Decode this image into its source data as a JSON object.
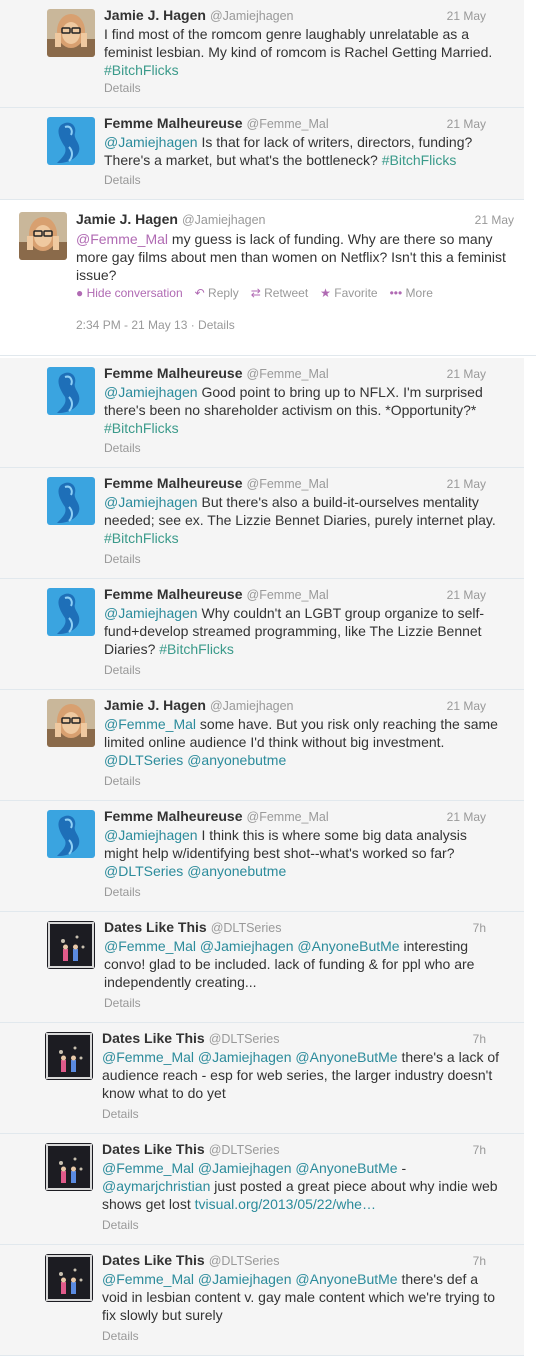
{
  "tweets": [
    {
      "name": "Jamie J. Hagen",
      "handle": "@Jamiejhagen",
      "time": "21 May",
      "avatar": "jamie",
      "segments": [
        {
          "t": "I find most of the romcom genre laughably unrelatable as a feminist lesbian.  My kind of romcom is Rachel Getting Married. ",
          "c": ""
        },
        {
          "t": "#BitchFlicks",
          "c": "hash"
        }
      ],
      "details": "Details"
    },
    {
      "name": "Femme Malheureuse",
      "handle": "@Femme_Mal",
      "time": "21 May",
      "avatar": "femme",
      "segments": [
        {
          "t": "@Jamiejhagen",
          "c": "mention"
        },
        {
          "t": " Is that for lack of writers, directors, funding? There's a market, but what's the bottleneck? ",
          "c": ""
        },
        {
          "t": "#BitchFlicks",
          "c": "hash"
        }
      ],
      "details": "Details"
    }
  ],
  "expanded": {
    "name": "Jamie J. Hagen",
    "handle": "@Jamiejhagen",
    "time": "21 May",
    "avatar": "jamie",
    "segments": [
      {
        "t": "@Femme_Mal",
        "c": "mention-purple"
      },
      {
        "t": " my guess is lack of funding. Why are there so many more gay films about men than women on Netflix? Isn't this a feminist issue?",
        "c": ""
      }
    ],
    "actions": {
      "hide": "Hide conversation",
      "reply": "Reply",
      "retweet": "Retweet",
      "favorite": "Favorite",
      "more": "More"
    },
    "timestamp": "2:34 PM - 21 May 13 · Details"
  },
  "replies": [
    {
      "name": "Femme Malheureuse",
      "handle": "@Femme_Mal",
      "time": "21 May",
      "avatar": "femme",
      "segments": [
        {
          "t": "@Jamiejhagen",
          "c": "mention"
        },
        {
          "t": " Good point to bring up to NFLX. I'm surprised there's been no shareholder activism on this. *Opportunity?* ",
          "c": ""
        },
        {
          "t": "#BitchFlicks",
          "c": "hash"
        }
      ],
      "details": "Details"
    },
    {
      "name": "Femme Malheureuse",
      "handle": "@Femme_Mal",
      "time": "21 May",
      "avatar": "femme",
      "segments": [
        {
          "t": "@Jamiejhagen",
          "c": "mention"
        },
        {
          "t": " But there's also a build-it-ourselves mentality needed; see ex. The Lizzie Bennet Diaries, purely internet play. ",
          "c": ""
        },
        {
          "t": "#BitchFlicks",
          "c": "hash"
        }
      ],
      "details": "Details"
    },
    {
      "name": "Femme Malheureuse",
      "handle": "@Femme_Mal",
      "time": "21 May",
      "avatar": "femme",
      "segments": [
        {
          "t": "@Jamiejhagen",
          "c": "mention"
        },
        {
          "t": " Why couldn't an LGBT group organize to self-fund+develop streamed programming, like The Lizzie Bennet Diaries? ",
          "c": ""
        },
        {
          "t": "#BitchFlicks",
          "c": "hash"
        }
      ],
      "details": "Details"
    },
    {
      "name": "Jamie J. Hagen",
      "handle": "@Jamiejhagen",
      "time": "21 May",
      "avatar": "jamie",
      "segments": [
        {
          "t": "@Femme_Mal",
          "c": "mention"
        },
        {
          "t": " some have. But you risk only reaching the same limited online audience I'd think without big investment. ",
          "c": ""
        },
        {
          "t": "@DLTSeries",
          "c": "mention"
        },
        {
          "t": " ",
          "c": ""
        },
        {
          "t": "@anyonebutme",
          "c": "mention"
        }
      ],
      "details": "Details"
    },
    {
      "name": "Femme Malheureuse",
      "handle": "@Femme_Mal",
      "time": "21 May",
      "avatar": "femme",
      "segments": [
        {
          "t": "@Jamiejhagen",
          "c": "mention"
        },
        {
          "t": " I think this is where some big data analysis might help w/identifying best shot--what's worked so far? ",
          "c": ""
        },
        {
          "t": "@DLTSeries",
          "c": "mention"
        },
        {
          "t": " ",
          "c": ""
        },
        {
          "t": "@anyonebutme",
          "c": "mention"
        }
      ],
      "details": "Details"
    },
    {
      "name": "Dates Like This",
      "handle": "@DLTSeries",
      "time": "7h",
      "avatar": "dlt",
      "segments": [
        {
          "t": "@Femme_Mal",
          "c": "mention"
        },
        {
          "t": " ",
          "c": ""
        },
        {
          "t": "@Jamiejhagen",
          "c": "mention"
        },
        {
          "t": " ",
          "c": ""
        },
        {
          "t": "@AnyoneButMe",
          "c": "mention"
        },
        {
          "t": " interesting convo! glad to be included. lack of funding & for ppl who are independently creating...",
          "c": ""
        }
      ],
      "details": "Details"
    },
    {
      "name": "Dates Like This",
      "handle": "@DLTSeries",
      "time": "7h",
      "avatar": "dlt",
      "segments": [
        {
          "t": "@Femme_Mal",
          "c": "mention"
        },
        {
          "t": " ",
          "c": ""
        },
        {
          "t": "@Jamiejhagen",
          "c": "mention"
        },
        {
          "t": " ",
          "c": ""
        },
        {
          "t": "@AnyoneButMe",
          "c": "mention"
        },
        {
          "t": " there's a lack of audience reach - esp for web series, the larger industry doesn't know what to do yet",
          "c": ""
        }
      ],
      "details": "Details"
    },
    {
      "name": "Dates Like This",
      "handle": "@DLTSeries",
      "time": "7h",
      "avatar": "dlt",
      "segments": [
        {
          "t": "@Femme_Mal",
          "c": "mention"
        },
        {
          "t": " ",
          "c": ""
        },
        {
          "t": "@Jamiejhagen",
          "c": "mention"
        },
        {
          "t": " ",
          "c": ""
        },
        {
          "t": "@AnyoneButMe",
          "c": "mention"
        },
        {
          "t": "  - ",
          "c": ""
        },
        {
          "t": "@aymarjchristian",
          "c": "mention"
        },
        {
          "t": " just posted a great piece about why indie web shows get lost ",
          "c": ""
        },
        {
          "t": "tvisual.org/2013/05/22/whe…",
          "c": "mention"
        }
      ],
      "details": "Details"
    },
    {
      "name": "Dates Like This",
      "handle": "@DLTSeries",
      "time": "7h",
      "avatar": "dlt",
      "segments": [
        {
          "t": "@Femme_Mal",
          "c": "mention"
        },
        {
          "t": " ",
          "c": ""
        },
        {
          "t": "@Jamiejhagen",
          "c": "mention"
        },
        {
          "t": " ",
          "c": ""
        },
        {
          "t": "@AnyoneButMe",
          "c": "mention"
        },
        {
          "t": " there's def a void in lesbian content v. gay male content which we're trying to fix slowly but surely",
          "c": ""
        }
      ],
      "details": "Details"
    }
  ]
}
